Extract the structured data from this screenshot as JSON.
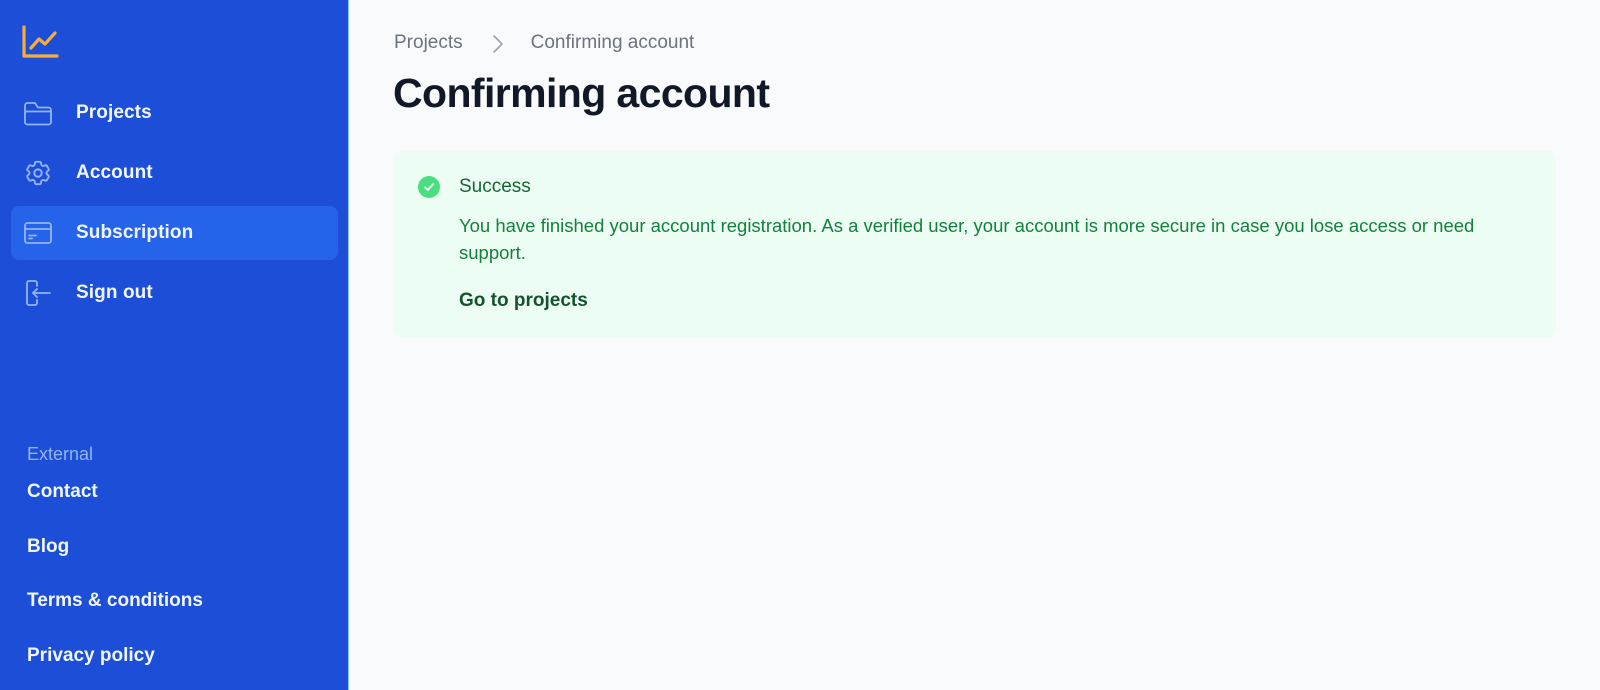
{
  "app": {
    "logo_icon": "chart-line-icon",
    "colors": {
      "sidebar_bg": "#1d4ed8",
      "sidebar_active_bg": "#2563eb",
      "logo_accent": "#f6ad3c",
      "success_bg": "#ecfdf3",
      "success_icon": "#4ade80",
      "success_text": "#15803d"
    }
  },
  "sidebar": {
    "items": [
      {
        "label": "Projects",
        "icon": "folder-icon",
        "active": false
      },
      {
        "label": "Account",
        "icon": "gear-icon",
        "active": false
      },
      {
        "label": "Subscription",
        "icon": "credit-card-icon",
        "active": true
      },
      {
        "label": "Sign out",
        "icon": "sign-out-icon",
        "active": false
      }
    ],
    "external": {
      "heading": "External",
      "links": [
        {
          "label": "Contact"
        },
        {
          "label": "Blog"
        },
        {
          "label": "Terms & conditions"
        },
        {
          "label": "Privacy policy"
        }
      ]
    }
  },
  "main": {
    "breadcrumb": [
      {
        "label": "Projects"
      },
      {
        "label": "Confirming account"
      }
    ],
    "title": "Confirming account",
    "alert": {
      "type": "success",
      "icon": "check-circle-icon",
      "title": "Success",
      "message": "You have finished your account registration. As a verified user, your account is more secure in case you lose access or need support.",
      "action_label": "Go to projects"
    }
  }
}
